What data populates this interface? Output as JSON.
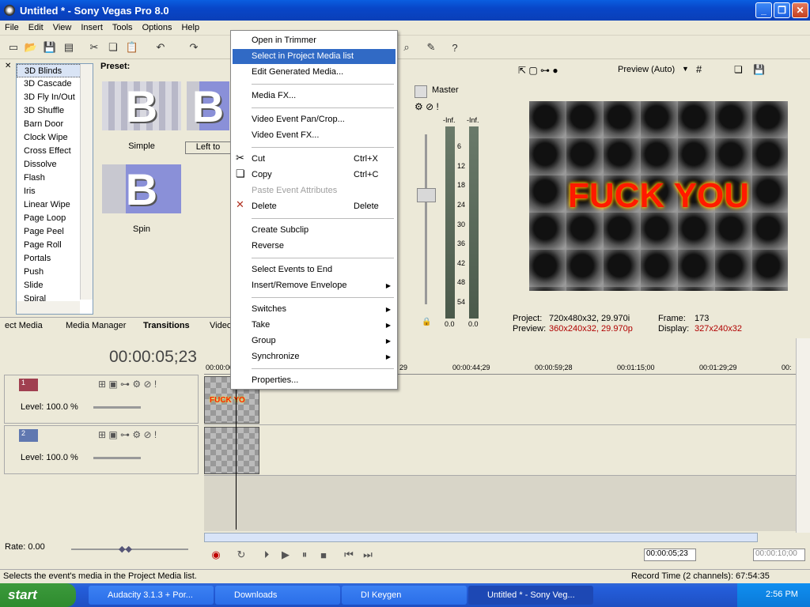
{
  "window": {
    "title": "Untitled * - Sony Vegas Pro 8.0"
  },
  "menubar": [
    "File",
    "Edit",
    "View",
    "Insert",
    "Tools",
    "Options",
    "Help"
  ],
  "transitions": {
    "list": [
      "3D Blinds",
      "3D Cascade",
      "3D Fly In/Out",
      "3D Shuffle",
      "Barn Door",
      "Clock Wipe",
      "Cross Effect",
      "Dissolve",
      "Flash",
      "Iris",
      "Linear Wipe",
      "Page Loop",
      "Page Peel",
      "Page Roll",
      "Portals",
      "Push",
      "Slide",
      "Spiral"
    ],
    "preset_label": "Preset:",
    "presets": [
      "Simple",
      "Left to",
      "Spin"
    ]
  },
  "tabs": [
    "ect Media",
    "Media Manager",
    "Transitions",
    "Video"
  ],
  "mixer": {
    "master": "Master",
    "peak_left": "-Inf.",
    "peak_right": "-Inf.",
    "scale": [
      "6",
      "12",
      "18",
      "24",
      "30",
      "36",
      "42",
      "48",
      "54"
    ],
    "bottom_left": "0.0",
    "bottom_right": "0.0"
  },
  "preview": {
    "mode": "Preview (Auto)",
    "video_text": "FUCK YOU",
    "project_label": "Project:",
    "project_value": "720x480x32, 29.970i",
    "preview_label": "Preview:",
    "preview_value": "360x240x32, 29.970p",
    "frame_label": "Frame:",
    "frame_value": "173",
    "display_label": "Display:",
    "display_value": "327x240x32"
  },
  "timeline": {
    "timecode": "00:00:05;23",
    "ruler": [
      "00:00:00;00",
      "29",
      "00:00:44;29",
      "00:00:59;28",
      "00:01:15;00",
      "00:01:29;29",
      "00:"
    ],
    "tracks": [
      {
        "num": "1",
        "level": "Level: 100.0 %",
        "clip_text": "FUCK YO"
      },
      {
        "num": "2",
        "level": "Level: 100.0 %"
      }
    ]
  },
  "transport": {
    "rate": "Rate: 0.00",
    "time1": "00:00:05;23",
    "time2": "00:00:10;00"
  },
  "status": {
    "left": "Selects the event's media in the Project Media list.",
    "right": "Record Time (2 channels): 67:54:35"
  },
  "context_menu": [
    {
      "label": "Open in Trimmer"
    },
    {
      "label": "Select in Project Media list",
      "highlight": true
    },
    {
      "label": "Edit Generated Media..."
    },
    {
      "label": "Media FX..."
    },
    {
      "label": "Video Event Pan/Crop..."
    },
    {
      "label": "Video Event FX..."
    },
    {
      "label": "Cut",
      "shortcut": "Ctrl+X"
    },
    {
      "label": "Copy",
      "shortcut": "Ctrl+C"
    },
    {
      "label": "Paste Event Attributes",
      "disabled": true
    },
    {
      "label": "Delete",
      "shortcut": "Delete"
    },
    {
      "label": "Create Subclip"
    },
    {
      "label": "Reverse"
    },
    {
      "label": "Select Events to End"
    },
    {
      "label": "Insert/Remove Envelope"
    },
    {
      "label": "Switches"
    },
    {
      "label": "Take"
    },
    {
      "label": "Group"
    },
    {
      "label": "Synchronize"
    },
    {
      "label": "Properties..."
    }
  ],
  "taskbar": {
    "start": "start",
    "tasks": [
      "Audacity 3.1.3 + Por...",
      "Downloads",
      "DI Keygen",
      "Untitled * - Sony Veg..."
    ],
    "clock": "2:56 PM"
  }
}
